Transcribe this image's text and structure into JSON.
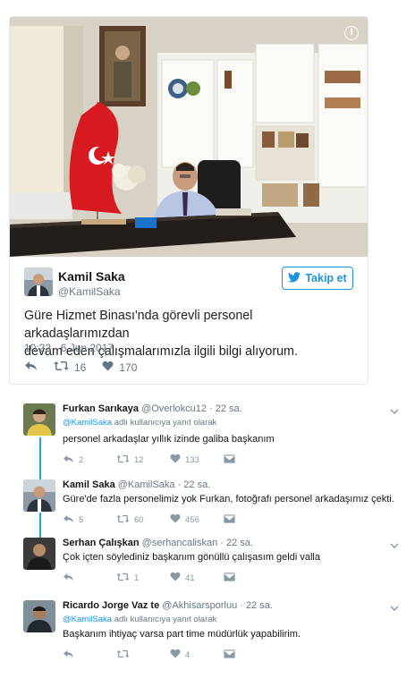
{
  "tweet": {
    "author_name": "Kamil Saka",
    "author_handle": "@KamilSaka",
    "follow_label": "Takip et",
    "text_line1": "Güre Hizmet Binası'nda görevli personel arkadaşlarımızdan",
    "text_line2": "devam eden çalışmalarımızla ilgili bilgi alıyorum.",
    "timestamp": "10:22 - 6 Jun 2017",
    "retweets": "16",
    "likes": "170"
  },
  "replies": [
    {
      "name": "Furkan Sarıkaya",
      "handle": "@Overlokcu12",
      "time": "· 22 sa.",
      "reply_to_mention": "@KamilSaka",
      "reply_to_suffix": " adlı kullanıcıya yanıt olarak",
      "text": "personel arkadaşlar yıllık izinde galiba başkanım",
      "replies_count": "2",
      "retweets_count": "12",
      "likes_count": "133"
    },
    {
      "name": "Kamil Saka",
      "handle": "@KamilSaka",
      "time": "· 22 sa.",
      "text": "Güre'de fazla personelimiz yok Furkan, fotoğrafı personel arkadaşımız çekti.",
      "replies_count": "5",
      "retweets_count": "60",
      "likes_count": "456"
    },
    {
      "name": "Serhan Çalışkan",
      "handle": "@serhancaliskan",
      "time": "· 22 sa.",
      "text": "Çok içten söylediniz başkanım gönüllü çalışasım geldi valla",
      "replies_count": "",
      "retweets_count": "1",
      "likes_count": "41"
    },
    {
      "name": "Ricardo Jorge Vaz te",
      "handle": "@Akhisarsporluu",
      "time": "· 22 sa.",
      "reply_to_mention": "@KamilSaka",
      "reply_to_suffix": " adlı kullanıcıya yanıt olarak",
      "text": "Başkanım ihtiyaç varsa part time müdürlük yapabilirim.",
      "replies_count": "",
      "retweets_count": "",
      "likes_count": "4"
    }
  ],
  "icons": {
    "reply": "reply-icon",
    "retweet": "retweet-icon",
    "like": "heart-icon",
    "dm": "envelope-icon",
    "more": "chevron-down-icon",
    "info": "info-icon",
    "twitter": "twitter-bird-icon"
  },
  "colors": {
    "accent": "#1b95e0",
    "thread_line": "#1da1f2",
    "secondary_text": "#657786"
  }
}
